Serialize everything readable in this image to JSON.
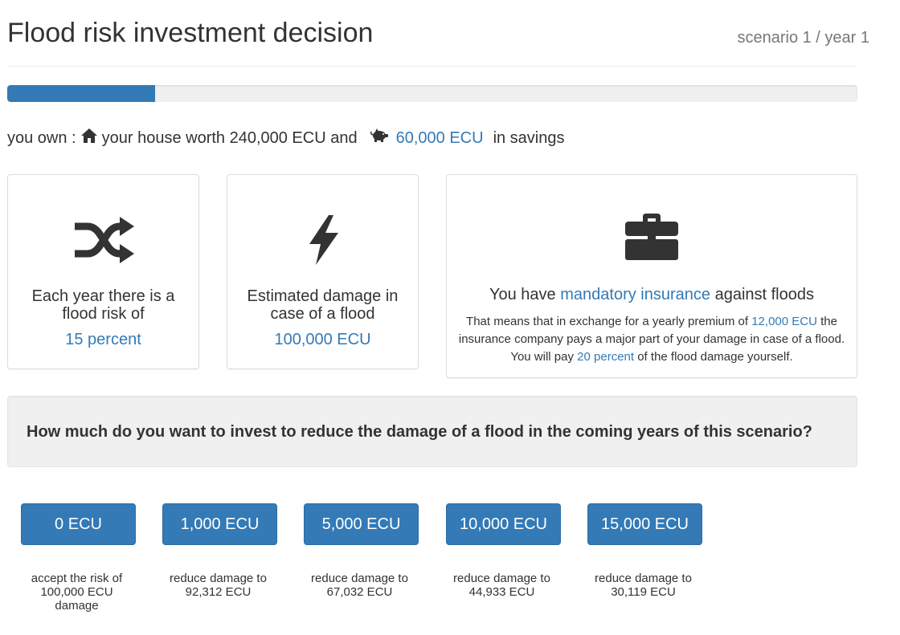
{
  "header": {
    "title": "Flood risk investment decision",
    "scenario": "scenario 1 / year 1"
  },
  "progress": {
    "fraction": 0.174
  },
  "assets": {
    "prefix": "you own :",
    "house_text": "your house worth 240,000 ECU and",
    "savings_value": "60,000 ECU",
    "savings_suffix": "in savings",
    "house_icon": "home-icon",
    "savings_icon": "piggy-bank-icon"
  },
  "risk_panel": {
    "icon": "shuffle-icon",
    "label": "Each year there is a flood risk of",
    "value": "15 percent"
  },
  "damage_panel": {
    "icon": "lightning-icon",
    "label": "Estimated damage in case of a flood",
    "value": "100,000 ECU"
  },
  "insurance_panel": {
    "icon": "briefcase-icon",
    "title_pre": "You have",
    "title_link": "mandatory insurance",
    "title_post": "against floods",
    "text_1": "That means that in exchange for a yearly premium of",
    "premium": "12,000 ECU",
    "text_2": "the insurance company pays a major part of your damage in case of a flood. You will pay",
    "own_share": "20 percent",
    "text_3": "of the flood damage yourself."
  },
  "question": "How much do you want to invest to reduce the damage of a flood in the coming years of this scenario?",
  "options": [
    {
      "label": "0 ECU",
      "caption": "accept the risk of 100,000 ECU damage"
    },
    {
      "label": "1,000 ECU",
      "caption": "reduce damage to 92,312 ECU"
    },
    {
      "label": "5,000 ECU",
      "caption": "reduce damage to 67,032 ECU"
    },
    {
      "label": "10,000 ECU",
      "caption": "reduce damage to 44,933 ECU"
    },
    {
      "label": "15,000 ECU",
      "caption": "reduce damage to 30,119 ECU"
    }
  ],
  "colors": {
    "accent": "#337ab7",
    "text": "#333333",
    "muted": "#777777"
  }
}
